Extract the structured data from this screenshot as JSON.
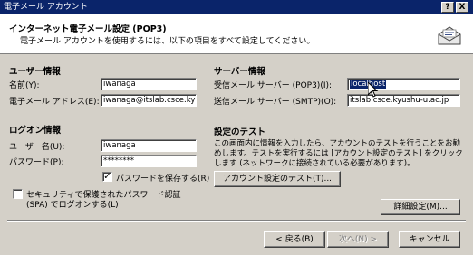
{
  "titlebar": {
    "title": "電子メール アカウント",
    "help": "?",
    "close": "X"
  },
  "header": {
    "title": "インターネット電子メール設定 (POP3)",
    "subtitle": "電子メール アカウントを使用するには、以下の項目をすべて設定してください。",
    "icon": "email-envelope-icon"
  },
  "user_info": {
    "heading": "ユーザー情報",
    "name_label": "名前(Y):",
    "name_value": "iwanaga",
    "email_label": "電子メール アドレス(E):",
    "email_value": "iwanaga@itslab.csce.kyu"
  },
  "logon_info": {
    "heading": "ログオン情報",
    "user_label": "ユーザー名(U):",
    "user_value": "iwanaga",
    "password_label": "パスワード(P):",
    "password_value": "********",
    "save_password_label": "パスワードを保存する(R)",
    "save_password_checked": true,
    "spa_label_1": "セキュリティで保護されたパスワード認証",
    "spa_label_2": "(SPA) でログオンする(L)",
    "spa_checked": false
  },
  "server_info": {
    "heading": "サーバー情報",
    "incoming_label": "受信メール サーバー (POP3)(I):",
    "incoming_value": "localhost",
    "outgoing_label": "送信メール サーバー (SMTP)(O):",
    "outgoing_value": "itslab.csce.kyushu-u.ac.jp"
  },
  "test_settings": {
    "heading": "設定のテスト",
    "description": "この画面内に情報を入力したら、アカウントのテストを行うことをお勧めします。テストを実行するには [アカウント設定のテスト] をクリックします (ネットワークに接続されている必要があります)。",
    "test_button": "アカウント設定のテスト(T)..."
  },
  "buttons": {
    "advanced": "詳細設定(M)...",
    "back": "< 戻る(B)",
    "next": "次へ(N) >",
    "cancel": "キャンセル"
  }
}
